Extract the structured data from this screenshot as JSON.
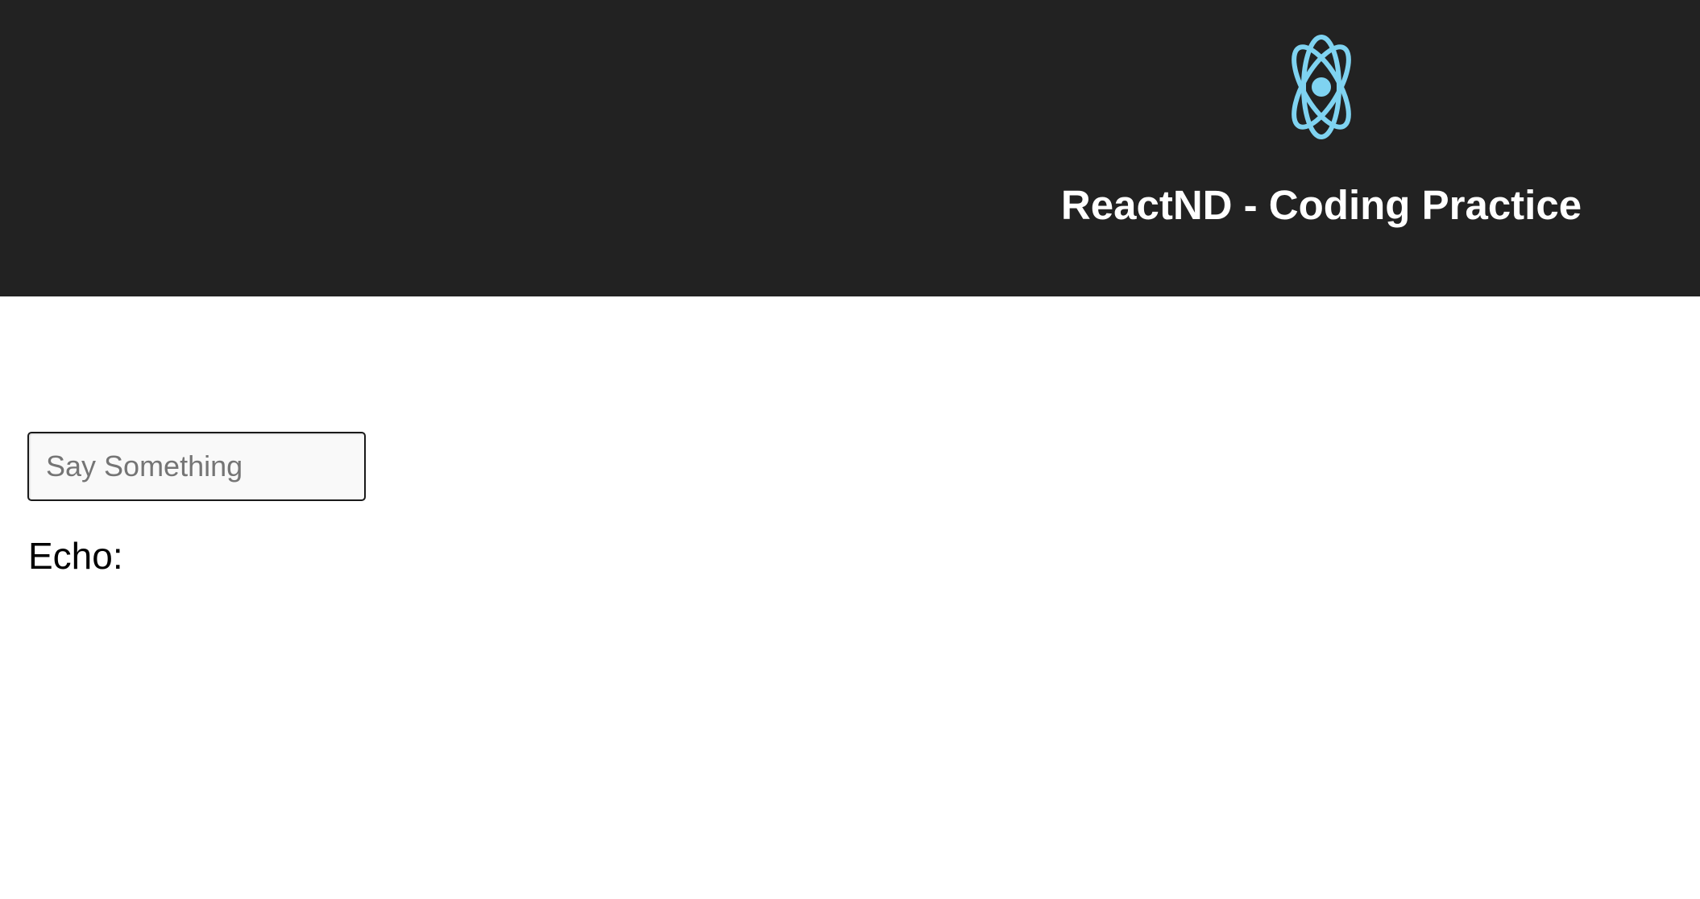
{
  "header": {
    "title": "ReactND - Coding Practice",
    "logo_icon": "react-atom-icon",
    "background_color": "#222222",
    "logo_color": "#61dafb"
  },
  "main": {
    "input": {
      "placeholder": "Say Something",
      "value": ""
    },
    "echo": {
      "label": "Echo:",
      "value": ""
    }
  }
}
